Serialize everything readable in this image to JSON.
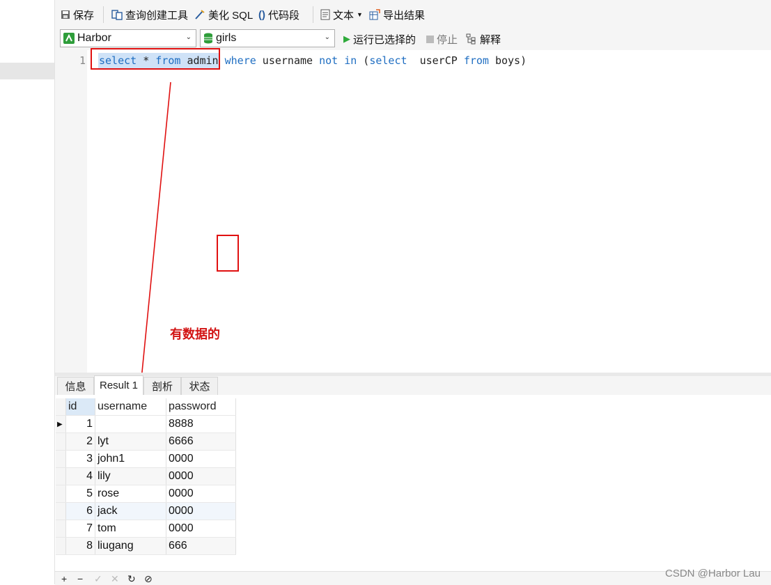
{
  "toolbar": {
    "save": "保存",
    "query_builder": "查询创建工具",
    "beautify_sql": "美化 SQL",
    "code_snippet": "代码段",
    "text": "文本",
    "export": "导出结果"
  },
  "toolbar2": {
    "connection": "Harbor",
    "database": "girls",
    "run_selected": "运行已选择的",
    "stop": "停止",
    "explain": "解释"
  },
  "editor": {
    "line_number": "1",
    "selected_code": "select * from admin",
    "code_rest": [
      {
        "text": " ",
        "kw": false
      },
      {
        "text": "where",
        "kw": true
      },
      {
        "text": " username ",
        "kw": false
      },
      {
        "text": "not",
        "kw": true
      },
      {
        "text": " ",
        "kw": false
      },
      {
        "text": "in",
        "kw": true
      },
      {
        "text": " (",
        "kw": false
      },
      {
        "text": "select",
        "kw": true
      },
      {
        "text": "  userCP ",
        "kw": false
      },
      {
        "text": "from",
        "kw": true
      },
      {
        "text": " boys)",
        "kw": false
      }
    ]
  },
  "annotation": "有数据的",
  "tabs": [
    "信息",
    "Result 1",
    "剖析",
    "状态"
  ],
  "grid": {
    "columns": [
      "id",
      "username",
      "password"
    ],
    "rows": [
      [
        "1",
        "",
        "8888"
      ],
      [
        "2",
        "lyt",
        "6666"
      ],
      [
        "3",
        "john1",
        "0000"
      ],
      [
        "4",
        "lily",
        "0000"
      ],
      [
        "5",
        "rose",
        "0000"
      ],
      [
        "6",
        "jack",
        "0000"
      ],
      [
        "7",
        "tom",
        "0000"
      ],
      [
        "8",
        "liugang",
        "666"
      ]
    ]
  },
  "watermark": "CSDN @Harbor Lau",
  "colors": {
    "accent": "#1f6ec2",
    "annotation": "#d21414",
    "selection": "#cfe2f7"
  }
}
